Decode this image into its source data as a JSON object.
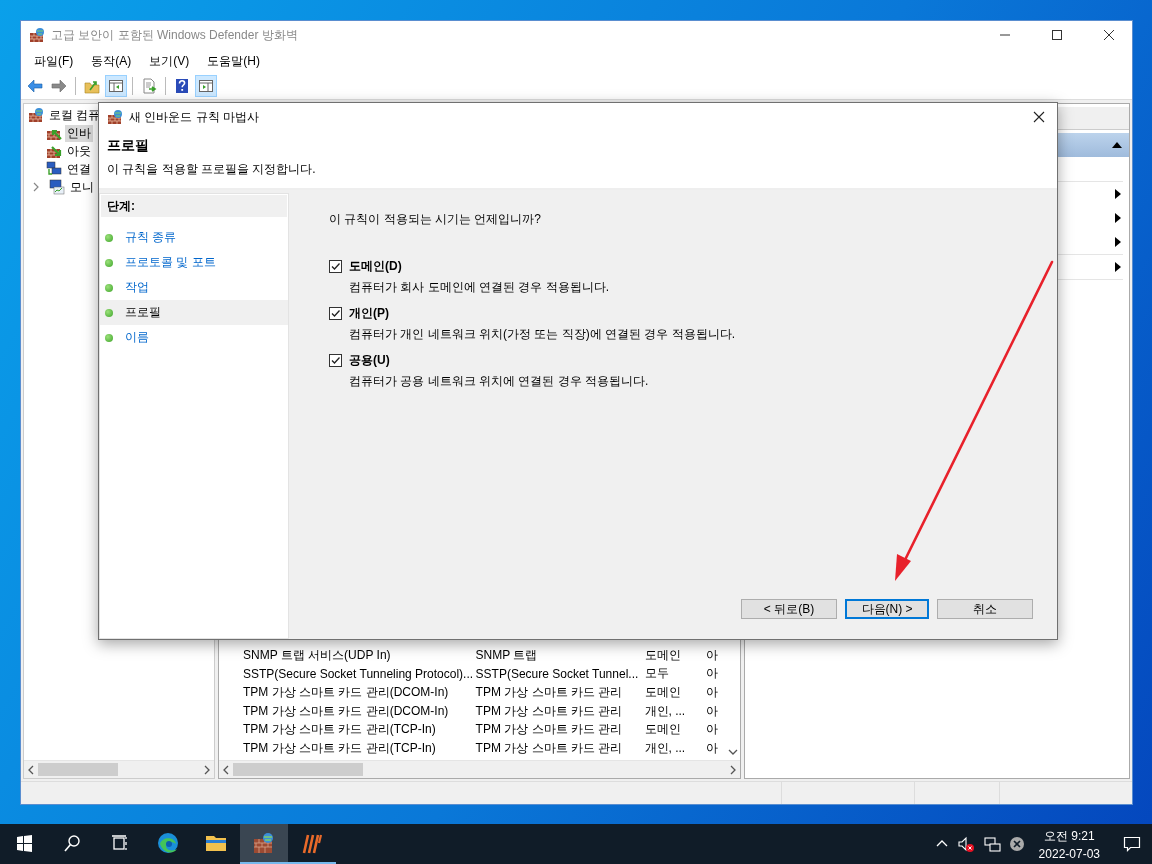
{
  "window": {
    "title": "고급 보안이 포함된 Windows Defender 방화벽"
  },
  "menu": [
    "파일(F)",
    "동작(A)",
    "보기(V)",
    "도움말(H)"
  ],
  "toolbar": [
    {
      "kind": "back",
      "pressed": false
    },
    {
      "kind": "forward",
      "pressed": false
    },
    {
      "kind": "up",
      "pressed": false
    },
    {
      "kind": "tree",
      "pressed": true
    },
    {
      "kind": "export",
      "pressed": false
    },
    {
      "kind": "help",
      "pressed": false
    },
    {
      "kind": "actions",
      "pressed": true
    }
  ],
  "tree": {
    "label": "로컬 컴퓨",
    "children": [
      {
        "label": "인바",
        "kind": "inbound",
        "selected": true,
        "collapsed": false
      },
      {
        "label": "아웃",
        "kind": "outbound",
        "selected": false,
        "collapsed": false
      },
      {
        "label": "연결",
        "kind": "security",
        "selected": false,
        "collapsed": false
      },
      {
        "label": "모니",
        "kind": "monitor",
        "selected": false,
        "collapsed": true
      }
    ]
  },
  "rules": [
    {
      "cells": [
        "SNMP 트랩 서비스(UDP In)",
        "SNMP 트랩",
        "도메인",
        "아"
      ]
    },
    {
      "cells": [
        "SSTP(Secure Socket Tunneling Protocol)...",
        "SSTP(Secure Socket Tunnel...",
        "모두",
        "아"
      ]
    },
    {
      "cells": [
        "TPM 가상 스마트 카드 관리(DCOM-In)",
        "TPM 가상 스마트 카드 관리",
        "도메인",
        "아"
      ]
    },
    {
      "cells": [
        "TPM 가상 스마트 카드 관리(DCOM-In)",
        "TPM 가상 스마트 카드 관리",
        "개인, ...",
        "아"
      ]
    },
    {
      "cells": [
        "TPM 가상 스마트 카드 관리(TCP-In)",
        "TPM 가상 스마트 카드 관리",
        "도메인",
        "아"
      ]
    },
    {
      "cells": [
        "TPM 가상 스마트 카드 관리(TCP-In)",
        "TPM 가상 스마트 카드 관리",
        "개인, ...",
        "아"
      ]
    }
  ],
  "dialog": {
    "title": "새 인바운드 규칙 마법사",
    "heading": "프로필",
    "subtitle": "이 규칙을 적용할 프로필을 지정합니다.",
    "steps_title": "단계:",
    "steps": [
      {
        "label": "규칙 종류",
        "selected": false
      },
      {
        "label": "프로토콜 및 포트",
        "selected": false
      },
      {
        "label": "작업",
        "selected": false
      },
      {
        "label": "프로필",
        "selected": true
      },
      {
        "label": "이름",
        "selected": false
      }
    ],
    "question": "이 규칙이 적용되는 시기는 언제입니까?",
    "options": [
      {
        "label": "도메인(D)",
        "checked": true,
        "description": "컴퓨터가 회사 도메인에 연결된 경우 적용됩니다."
      },
      {
        "label": "개인(P)",
        "checked": true,
        "description": "컴퓨터가 개인 네트워크 위치(가정 또는 직장)에 연결된 경우 적용됩니다."
      },
      {
        "label": "공용(U)",
        "checked": true,
        "description": "컴퓨터가 공용 네트워크 위치에 연결된 경우 적용됩니다."
      }
    ],
    "buttons": [
      {
        "label": "< 뒤로(B)",
        "default": false
      },
      {
        "label": "다음(N) >",
        "default": true
      },
      {
        "label": "취소",
        "default": false
      }
    ]
  },
  "taskbar": {
    "apps": [
      {
        "kind": "edge",
        "active": false,
        "running": false
      },
      {
        "kind": "explorer",
        "active": false,
        "running": false
      },
      {
        "kind": "firewall",
        "active": true,
        "running": true
      },
      {
        "kind": "stripes",
        "active": false,
        "running": true
      }
    ],
    "clock_time": "오전 9:21",
    "clock_date": "2022-07-03"
  }
}
